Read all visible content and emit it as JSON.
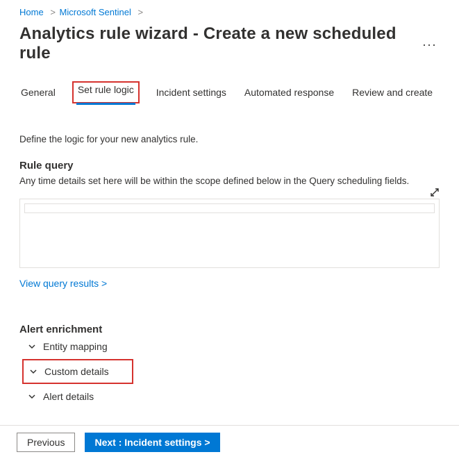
{
  "breadcrumb": {
    "home": "Home",
    "sentinel": "Microsoft Sentinel"
  },
  "page_title": "Analytics rule wizard - Create a new scheduled rule",
  "tabs": {
    "general": "General",
    "set_rule_logic": "Set rule logic",
    "incident_settings": "Incident settings",
    "automated_response": "Automated response",
    "review_create": "Review and create"
  },
  "intro": "Define the logic for your new analytics rule.",
  "rule_query": {
    "heading": "Rule query",
    "desc": "Any time details set here will be within the scope defined below in the Query scheduling fields.",
    "view_results": "View query results  >"
  },
  "enrichment": {
    "heading": "Alert enrichment",
    "entity_mapping": "Entity mapping",
    "custom_details": "Custom details",
    "alert_details": "Alert details"
  },
  "footer": {
    "previous": "Previous",
    "next": "Next : Incident settings  >"
  }
}
